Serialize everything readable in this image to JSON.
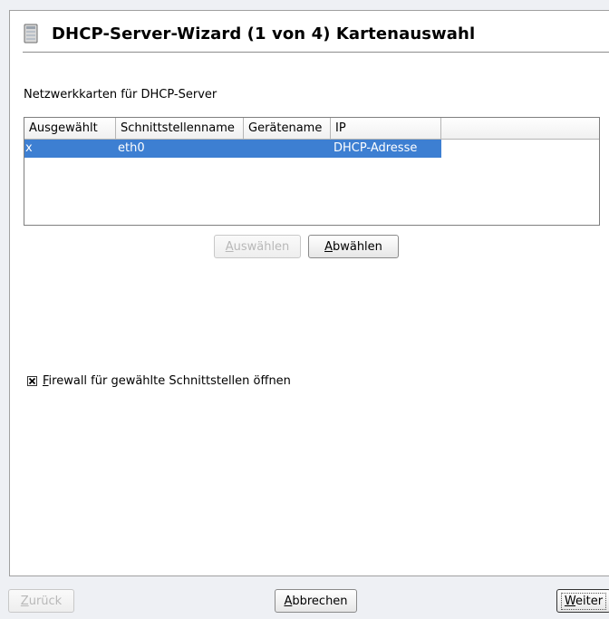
{
  "window": {
    "title": "DHCP-Server-Wizard (1 von 4) Kartenauswahl",
    "icon": "dhcp-server-icon"
  },
  "cards_section": {
    "label": "Netzwerkkarten für DHCP-Server",
    "columns": [
      "Ausgewählt",
      "Schnittstellenname",
      "Gerätename",
      "IP"
    ],
    "rows": [
      {
        "selected": "x",
        "interface": "eth0",
        "device": "",
        "ip": "DHCP-Adresse",
        "highlighted": true
      }
    ],
    "select_button": {
      "accel": "A",
      "rest": "uswählen",
      "enabled": false
    },
    "deselect_button": {
      "accel": "A",
      "rest": "bwählen",
      "enabled": true
    }
  },
  "firewall": {
    "checked": true,
    "accel": "F",
    "rest": "irewall für gewählte Schnittstellen öffnen"
  },
  "footer": {
    "back": {
      "accel": "Z",
      "rest": "urück",
      "enabled": false
    },
    "cancel": {
      "accel": "A",
      "rest": "bbrechen",
      "enabled": true
    },
    "next": {
      "accel": "W",
      "rest": "eiter",
      "enabled": true,
      "default": true
    }
  },
  "colors": {
    "selection": "#3d7fd2",
    "background": "#eef0f4"
  }
}
